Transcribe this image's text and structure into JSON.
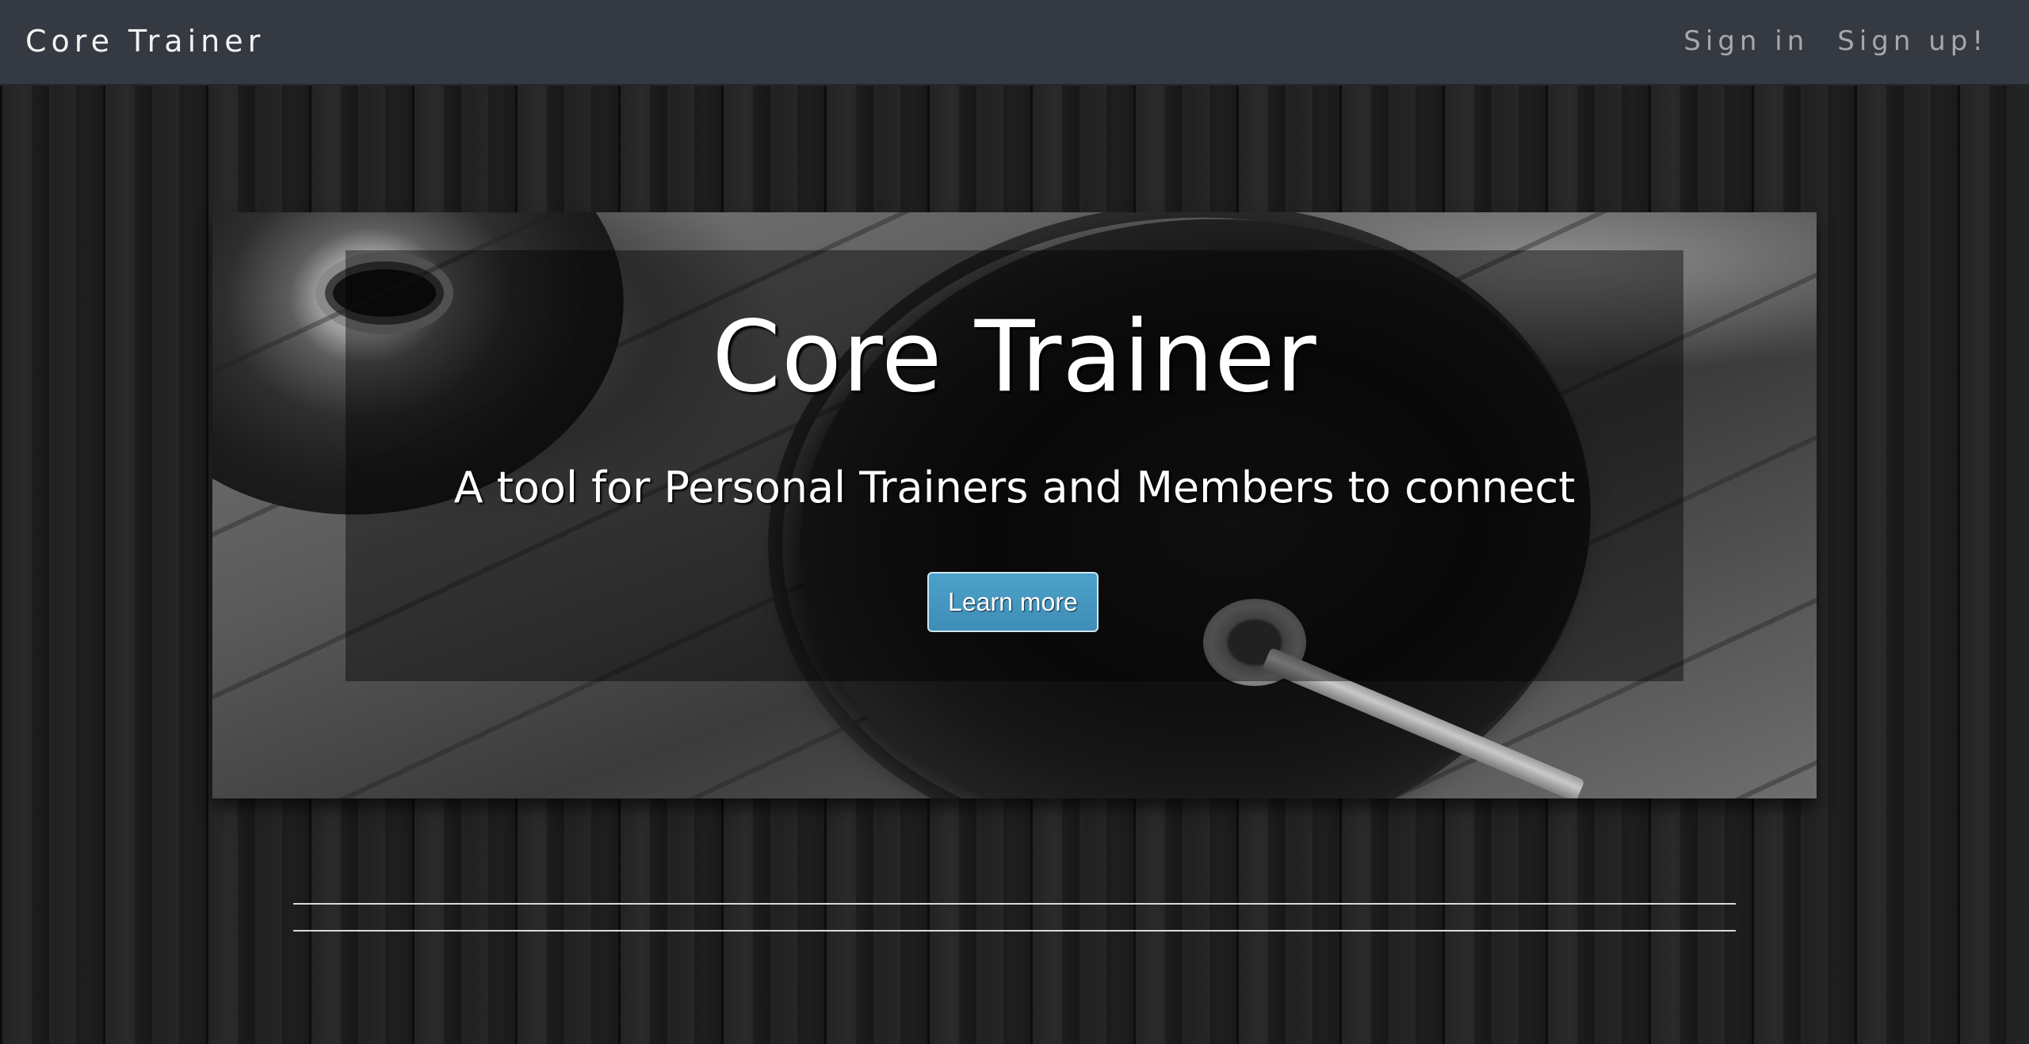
{
  "navbar": {
    "brand": "Core Trainer",
    "links": [
      {
        "label": "Sign in"
      },
      {
        "label": "Sign up!"
      }
    ]
  },
  "hero": {
    "title": "Core Trainer",
    "subtitle": "A tool for Personal Trainers and Members to connect",
    "button_label": "Learn more"
  }
}
